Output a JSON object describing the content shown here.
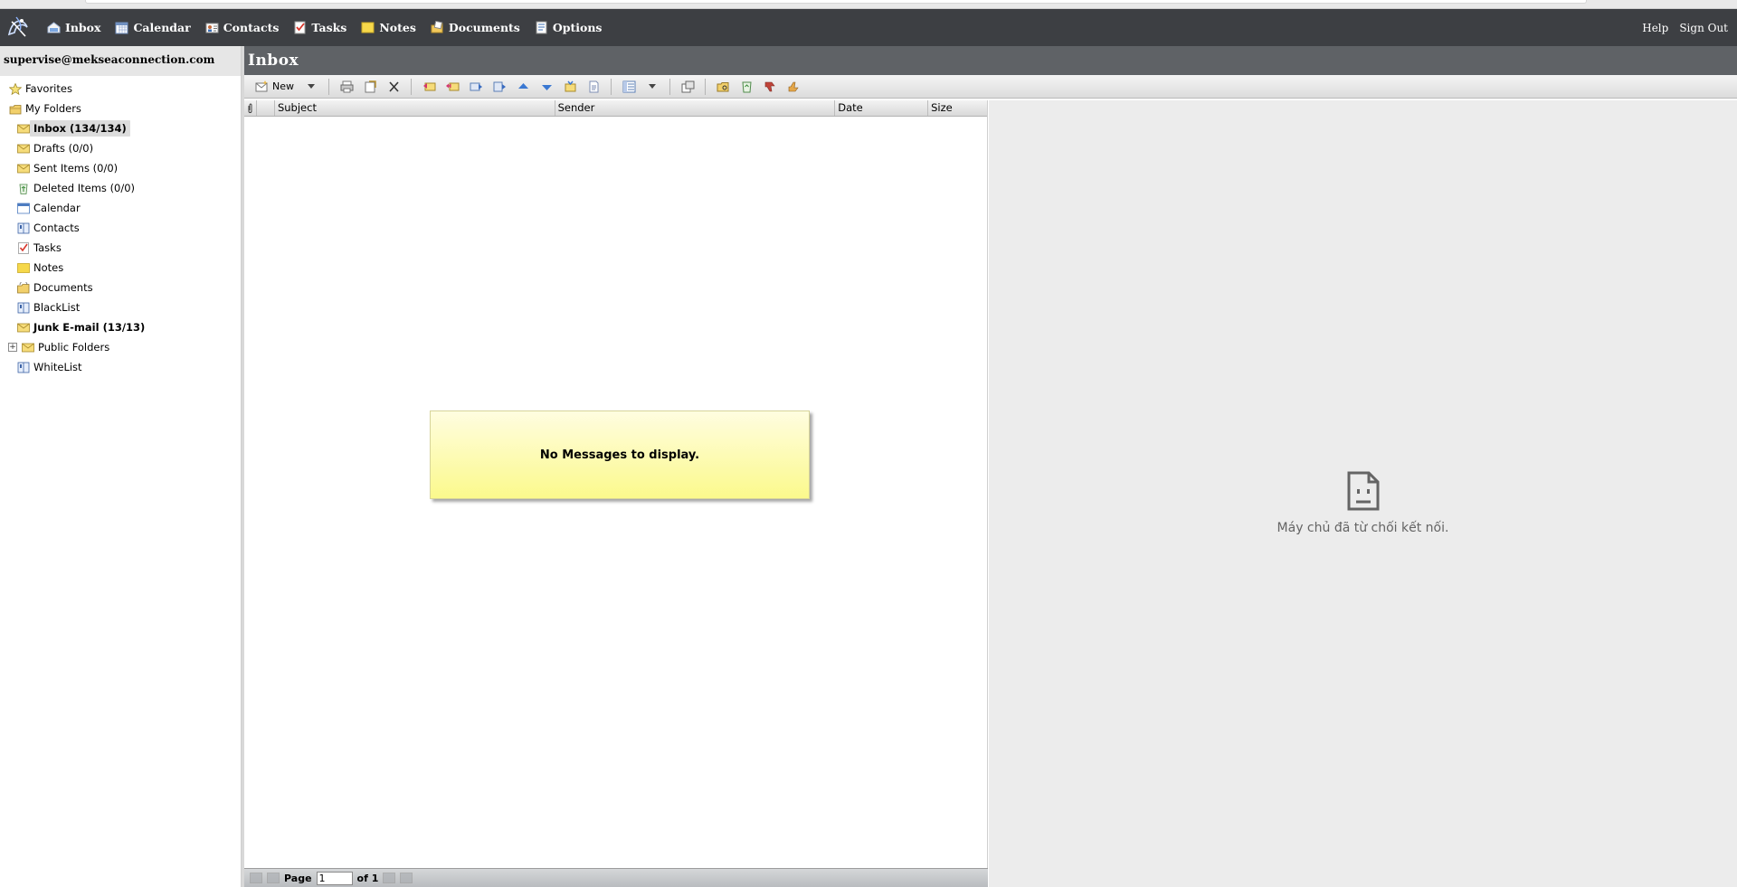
{
  "app": {
    "nav": [
      {
        "id": "inbox",
        "label": "Inbox",
        "icon": "inbox-icon"
      },
      {
        "id": "calendar",
        "label": "Calendar",
        "icon": "calendar-icon"
      },
      {
        "id": "contacts",
        "label": "Contacts",
        "icon": "contacts-icon"
      },
      {
        "id": "tasks",
        "label": "Tasks",
        "icon": "tasks-icon"
      },
      {
        "id": "notes",
        "label": "Notes",
        "icon": "notes-icon"
      },
      {
        "id": "documents",
        "label": "Documents",
        "icon": "documents-icon"
      },
      {
        "id": "options",
        "label": "Options",
        "icon": "options-icon"
      }
    ],
    "help_label": "Help",
    "signout_label": "Sign Out"
  },
  "sidebar": {
    "user": "supervise@mekseaconnection.com",
    "favorites": "Favorites",
    "my_folders": "My Folders",
    "folders": [
      {
        "label": "Inbox (134/134)",
        "icon": "envelope-icon"
      },
      {
        "label": "Drafts (0/0)",
        "icon": "envelope-icon"
      },
      {
        "label": "Sent Items (0/0)",
        "icon": "envelope-icon"
      },
      {
        "label": "Deleted Items (0/0)",
        "icon": "recycle-bin-icon"
      },
      {
        "label": "Calendar",
        "icon": "calendar-icon"
      },
      {
        "label": "Contacts",
        "icon": "address-book-icon"
      },
      {
        "label": "Tasks",
        "icon": "tasks-icon"
      },
      {
        "label": "Notes",
        "icon": "notes-icon"
      },
      {
        "label": "Documents",
        "icon": "documents-icon"
      },
      {
        "label": "BlackList",
        "icon": "address-book-icon"
      },
      {
        "label": "Junk E-mail (13/13)",
        "icon": "envelope-icon"
      },
      {
        "label": "Public Folders",
        "icon": "envelope-icon"
      },
      {
        "label": "WhiteList",
        "icon": "address-book-icon"
      }
    ]
  },
  "main": {
    "title": "Inbox",
    "toolbar": {
      "new_label": "New"
    },
    "columns": {
      "subject": "Subject",
      "sender": "Sender",
      "date": "Date",
      "size": "Size"
    },
    "empty_message": "No Messages to display.",
    "pager": {
      "page_label": "Page",
      "page_value": "1",
      "of_label": "of 1"
    }
  },
  "preview": {
    "error_text": "Máy chủ đã từ chối kết nối."
  },
  "colors": {
    "navbar": "#3d3f43",
    "header": "#5f6266",
    "empty_bg": "#fbf98c",
    "preview_bg": "#ececec"
  }
}
